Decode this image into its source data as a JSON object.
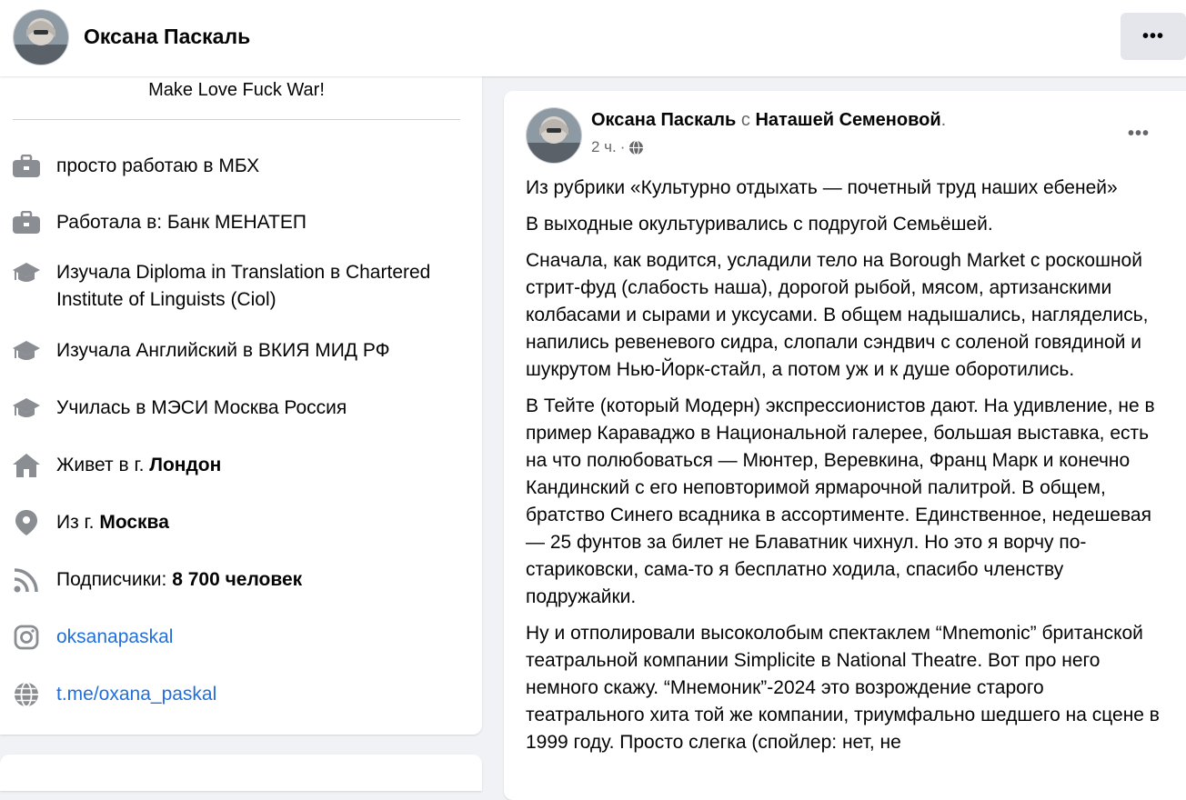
{
  "header": {
    "profile_name": "Оксана Паскаль",
    "more_label": "•••"
  },
  "intro": {
    "bio": "Make Love Fuck War!",
    "items": [
      {
        "icon": "briefcase-icon",
        "text": "просто работаю в МБХ"
      },
      {
        "icon": "briefcase-icon",
        "text": "Работала в: Банк МЕНАТЕП"
      },
      {
        "icon": "graduation-cap-icon",
        "text": "Изучала Diploma in Translation в Chartered Institute of Linguists (Ciol)"
      },
      {
        "icon": "graduation-cap-icon",
        "text": "Изучала Английский в ВКИЯ МИД РФ"
      },
      {
        "icon": "graduation-cap-icon",
        "text": "Училась в МЭСИ Москва Россия"
      },
      {
        "icon": "home-icon",
        "prefix": "Живет в г. ",
        "bold": "Лондон"
      },
      {
        "icon": "location-pin-icon",
        "prefix": "Из г. ",
        "bold": "Москва"
      },
      {
        "icon": "rss-icon",
        "prefix": "Подписчики: ",
        "bold": "8 700 человек"
      },
      {
        "icon": "instagram-icon",
        "link": "oksanapaskal"
      },
      {
        "icon": "globe-icon",
        "link": "t.me/oxana_paskal"
      }
    ]
  },
  "post": {
    "author": "Оксана Паскаль",
    "with_word": "с",
    "tagged": "Наташей Семеновой",
    "period": ".",
    "time": "2 ч.",
    "dot": "·",
    "privacy_icon": "globe-icon",
    "more_label": "•••",
    "paragraphs": [
      "Из рубрики «Культурно отдыхать — почетный труд наших ебеней»",
      "В выходные окультуривались с подругой Семьёшей.",
      "Сначала, как водится, усладили тело на Borough Market с роскошной стрит-фуд (слабость наша), дорогой рыбой, мясом, артизанскими колбасами и сырами и уксусами. В общем надышались, нагляделись, напились ревеневого сидра, слопали сэндвич с соленой говядиной и шукрутом Нью-Йорк-стайл, а потом уж и к душе оборотились.",
      "В Тейте (который Модерн) экспрессионистов дают. На удивление, не в пример Караваджо в Национальной галерее, большая выставка, есть на что полюбоваться — Мюнтер, Веревкина, Франц Марк и конечно Кандинский с его неповторимой ярмарочной палитрой. В общем, братство Синего всадника в ассортименте. Единственное, недешевая — 25 фунтов за билет не Блаватник чихнул. Но это я ворчу по-стариковски, сама-то я бесплатно ходила, спасибо членству подружайки.",
      "Ну и отполировали высоколобым спектаклем “Mnemonic” британской театральной компании Simplicite в National Theatre. Вот про него немного скажу. “Мнемоник”-2024 это возрождение старого театрального хита той же компании, триумфально шедшего на сцене в 1999 году. Просто слегка (спойлер: нет, не"
    ]
  }
}
